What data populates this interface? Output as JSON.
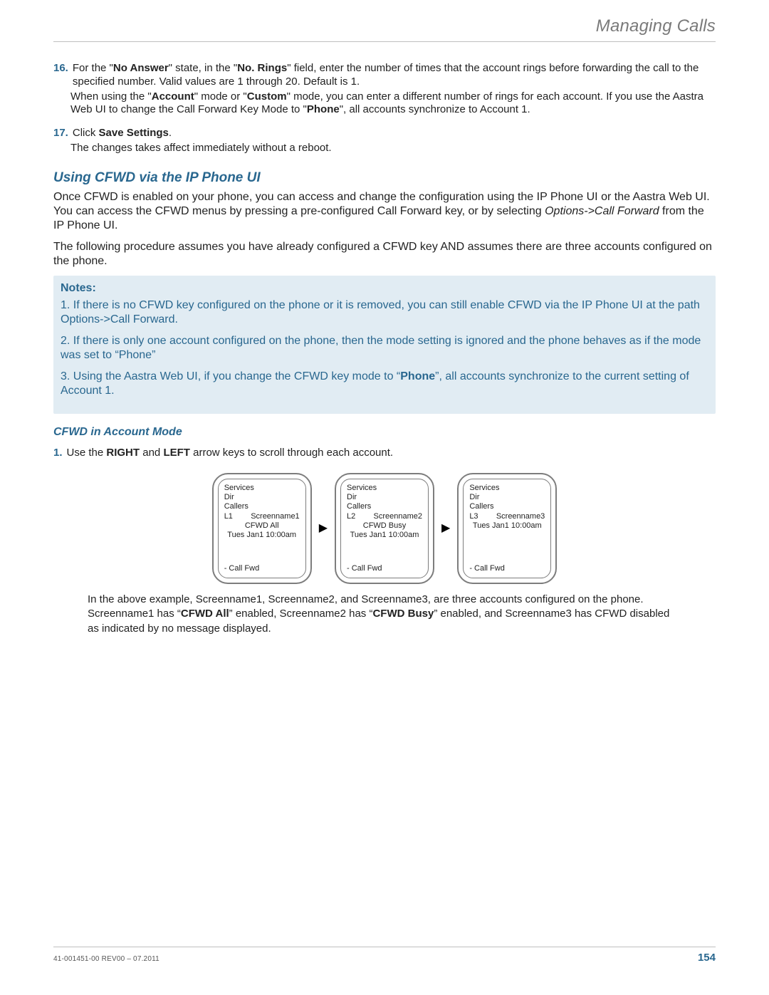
{
  "header": {
    "running": "Managing Calls"
  },
  "steps": {
    "s16": {
      "num": "16.",
      "line1a": "For the \"",
      "line1b": "No Answer",
      "line1c": "\" state, in the \"",
      "line1d": "No. Rings",
      "line1e": "\" field, enter the number of times that the account rings before forwarding the call to the specified number. Valid values are 1 through 20. Default is 1.",
      "line2a": "When using the \"",
      "line2b": "Account",
      "line2c": "\" mode or \"",
      "line2d": "Custom",
      "line2e": "\" mode, you can enter a different number of rings for each account. If you use the Aastra Web UI to change the Call Forward Key Mode to \"",
      "line2f": "Phone",
      "line2g": "\", all accounts synchronize to Account 1."
    },
    "s17": {
      "num": "17.",
      "line1a": "Click ",
      "line1b": "Save Settings",
      "line1c": ".",
      "line2": "The changes takes affect immediately without a reboot."
    }
  },
  "section": {
    "title": "Using CFWD via the IP Phone UI"
  },
  "para1a": "Once CFWD is enabled on your phone, you can access and change the configuration using the IP Phone UI or the Aastra Web UI. You can access the CFWD menus by pressing a pre-configured Call Forward key, or by selecting ",
  "para1b": "Options->Call Forward",
  "para1c": " from the IP Phone UI.",
  "para2": "The following procedure assumes you have already configured a CFWD key AND assumes there are three accounts configured on the phone.",
  "notes": {
    "label": "Notes:",
    "n1": "1. If there is no CFWD key configured on the phone or it is removed, you can still enable CFWD via the IP Phone UI at the path Options->Call Forward.",
    "n2": "2. If there is only one account configured on the phone, then the mode setting is ignored and the phone behaves as if the mode was set to “Phone”",
    "n3a": "3. Using the Aastra Web UI, if you change the CFWD key mode to “",
    "n3b": "Phone",
    "n3c": "”, all accounts synchronize to the current setting of Account 1."
  },
  "sub": {
    "title": "CFWD in Account Mode"
  },
  "step1": {
    "num": "1.",
    "a": "Use the ",
    "b": "RIGHT",
    "c": " and ",
    "d": "LEFT",
    "e": " arrow keys to scroll through each account."
  },
  "screens": [
    {
      "services": "Services",
      "dir": "Dir",
      "callers": "Callers",
      "line": "L1",
      "name": "Screenname1",
      "status": "CFWD All",
      "date": "Tues Jan1 10:00am",
      "cf": "- Call Fwd"
    },
    {
      "services": "Services",
      "dir": "Dir",
      "callers": "Callers",
      "line": "L2",
      "name": "Screenname2",
      "status": "CFWD Busy",
      "date": "Tues Jan1 10:00am",
      "cf": "- Call Fwd"
    },
    {
      "services": "Services",
      "dir": "Dir",
      "callers": "Callers",
      "line": "L3",
      "name": "Screenname3",
      "status": "",
      "date": "Tues Jan1 10:00am",
      "cf": "- Call Fwd"
    }
  ],
  "arrow": "▶",
  "caption": {
    "a": "In the above example, Screenname1, Screenname2, and Screenname3, are three accounts configured on the phone. Screenname1 has “",
    "b": "CFWD All",
    "c": "” enabled, Screenname2 has “",
    "d": "CFWD Busy",
    "e": "” enabled, and Screenname3 has CFWD disabled as indicated by no message displayed."
  },
  "footer": {
    "doc": "41-001451-00 REV00 – 07.2011",
    "page": "154"
  }
}
